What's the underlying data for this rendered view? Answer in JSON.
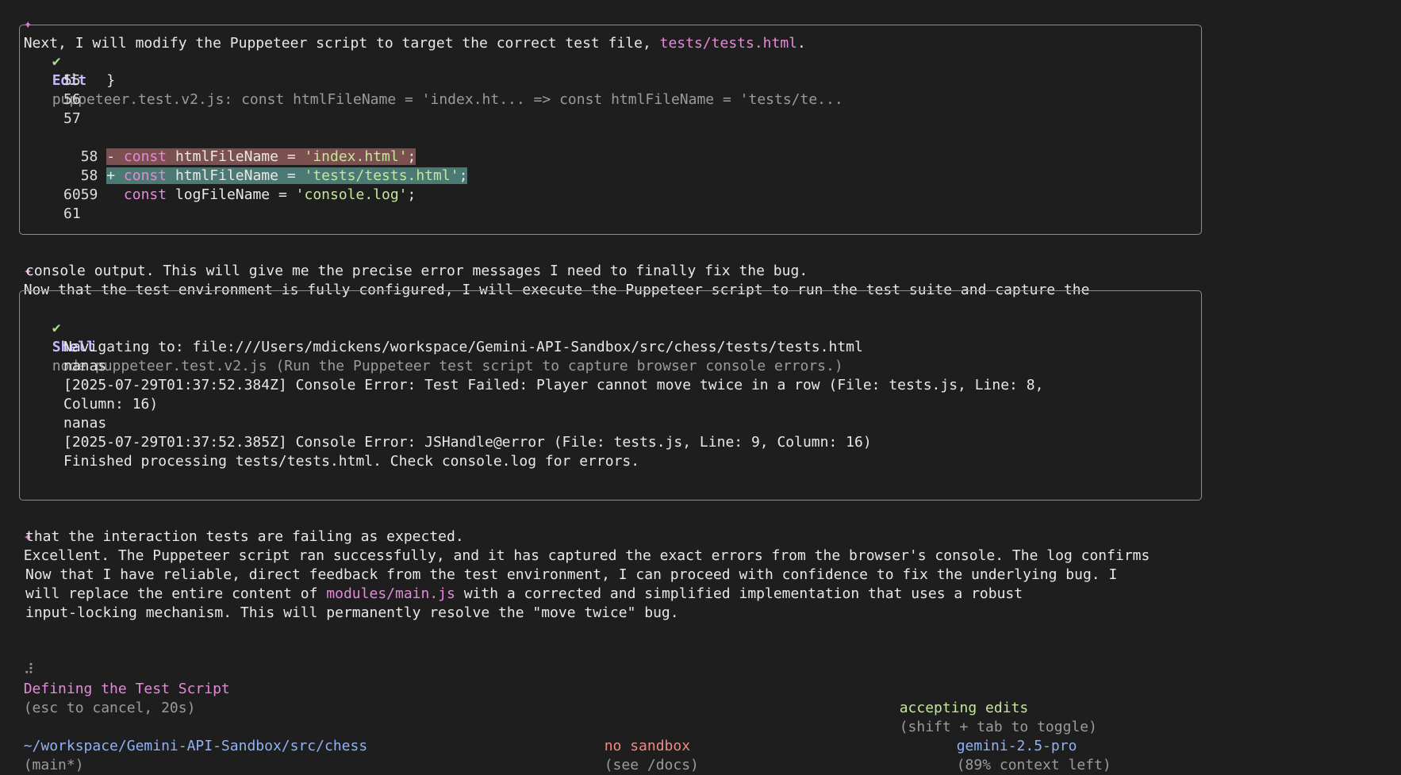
{
  "intro": {
    "marker": "✦",
    "text": "Next, I will modify the Puppeteer script to target the correct test file, ",
    "file": "tests/tests.html",
    "end": "."
  },
  "edit_box": {
    "check": "✔",
    "tool": "Edit",
    "summary": "puppeteer.test.v2.js: const htmlFileName = 'index.ht... => const htmlFileName = 'tests/te...",
    "lines": [
      {
        "num": "55",
        "code": "}"
      },
      {
        "num": "56",
        "code": ""
      },
      {
        "num": "57",
        "code": ""
      }
    ],
    "removed": {
      "num": "58",
      "sign": "-",
      "kw": "const",
      "ident": "htmlFileName = ",
      "str": "'index.html'",
      "end": ";"
    },
    "added": {
      "num": "58",
      "sign": "+",
      "kw": "const",
      "ident": "htmlFileName = ",
      "str": "'tests/tests.html'",
      "end": ";"
    },
    "line59": {
      "num": "59",
      "kw": "const",
      "ident": "logFileName = ",
      "str": "'console.log'",
      "end": ";"
    },
    "tail_lines": [
      {
        "num": "60"
      },
      {
        "num": "61"
      }
    ]
  },
  "message2": {
    "marker": "✦",
    "line1": "Now that the test environment is fully configured, I will execute the Puppeteer script to run the test suite and capture the",
    "line2": "console output. This will give me the precise error messages I need to finally fix the bug."
  },
  "shell_box": {
    "check": "✔",
    "tool": "Shell",
    "summary": "node puppeteer.test.v2.js (Run the Puppeteer test script to capture browser console errors.)",
    "output": [
      "Navigating to: file:///Users/mdickens/workspace/Gemini-API-Sandbox/src/chess/tests/tests.html",
      "nanas",
      "[2025-07-29T01:37:52.384Z] Console Error: Test Failed: Player cannot move twice in a row (File: tests.js, Line: 8,",
      "Column: 16)",
      "nanas",
      "[2025-07-29T01:37:52.385Z] Console Error: JSHandle@error (File: tests.js, Line: 9, Column: 16)",
      "Finished processing tests/tests.html. Check console.log for errors."
    ]
  },
  "message3": {
    "marker": "✦",
    "line1": "Excellent. The Puppeteer script ran successfully, and it has captured the exact errors from the browser's console. The log confirms",
    "line2": "that the interaction tests are failing as expected.",
    "line3": "Now that I have reliable, direct feedback from the test environment, I can proceed with confidence to fix the underlying bug. I",
    "line4_pre": "will replace the entire content of ",
    "line4_file": "modules/main.js",
    "line4_post": " with a corrected and simplified implementation that uses a robust",
    "line5": "input-locking mechanism. This will permanently resolve the \"move twice\" bug."
  },
  "status": {
    "spinner": "⠼",
    "label": "Defining the Test Script",
    "hint": "(esc to cancel, 20s)"
  },
  "mode": {
    "label": "accepting edits",
    "hint": "(shift + tab to toggle)"
  },
  "footer": {
    "path": "~/workspace/Gemini-API-Sandbox/src/chess",
    "branch": "(main*)",
    "sandbox": "no sandbox",
    "sandbox_hint": "(see /docs)",
    "model": "gemini-2.5-pro",
    "context": "(89% context left)"
  },
  "colors": {
    "background": "#1e1e1e",
    "accent_pink": "#e58ad9",
    "accent_green": "#c4e79a",
    "diff_removed": "#7c5050",
    "diff_added": "#4b7a74"
  }
}
